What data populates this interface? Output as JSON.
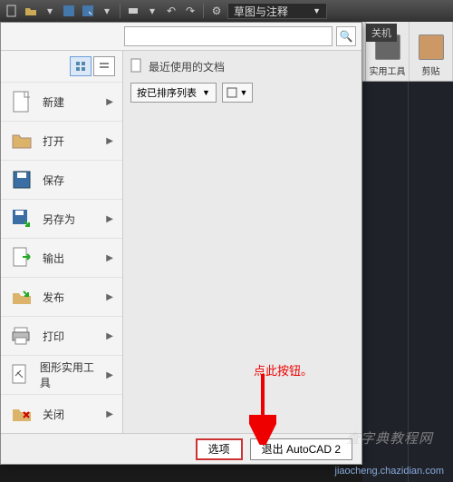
{
  "qat": {
    "workspace_label": "草图与注释"
  },
  "ribbon": {
    "tab_label": "关机",
    "panels": [
      {
        "label": "实用工具"
      },
      {
        "label": "剪贴"
      }
    ]
  },
  "menu": {
    "search_placeholder": "",
    "recent_header": "最近使用的文档",
    "sort_label": "按已排序列表",
    "items": [
      {
        "label": "新建",
        "icon": "file-new",
        "arrow": true
      },
      {
        "label": "打开",
        "icon": "folder-open",
        "arrow": true
      },
      {
        "label": "保存",
        "icon": "save",
        "arrow": false
      },
      {
        "label": "另存为",
        "icon": "save-as",
        "arrow": true
      },
      {
        "label": "输出",
        "icon": "export",
        "arrow": true
      },
      {
        "label": "发布",
        "icon": "publish",
        "arrow": true
      },
      {
        "label": "打印",
        "icon": "print",
        "arrow": true
      },
      {
        "label": "图形实用工具",
        "icon": "tools",
        "arrow": true
      },
      {
        "label": "关闭",
        "icon": "close",
        "arrow": true
      }
    ],
    "footer": {
      "options_label": "选项",
      "exit_label": "退出 AutoCAD 2"
    }
  },
  "annotation": {
    "text": "点此按钮。"
  },
  "watermarks": {
    "w1": "查字典教程网",
    "w2": "jiaocheng.chazidian.com"
  }
}
